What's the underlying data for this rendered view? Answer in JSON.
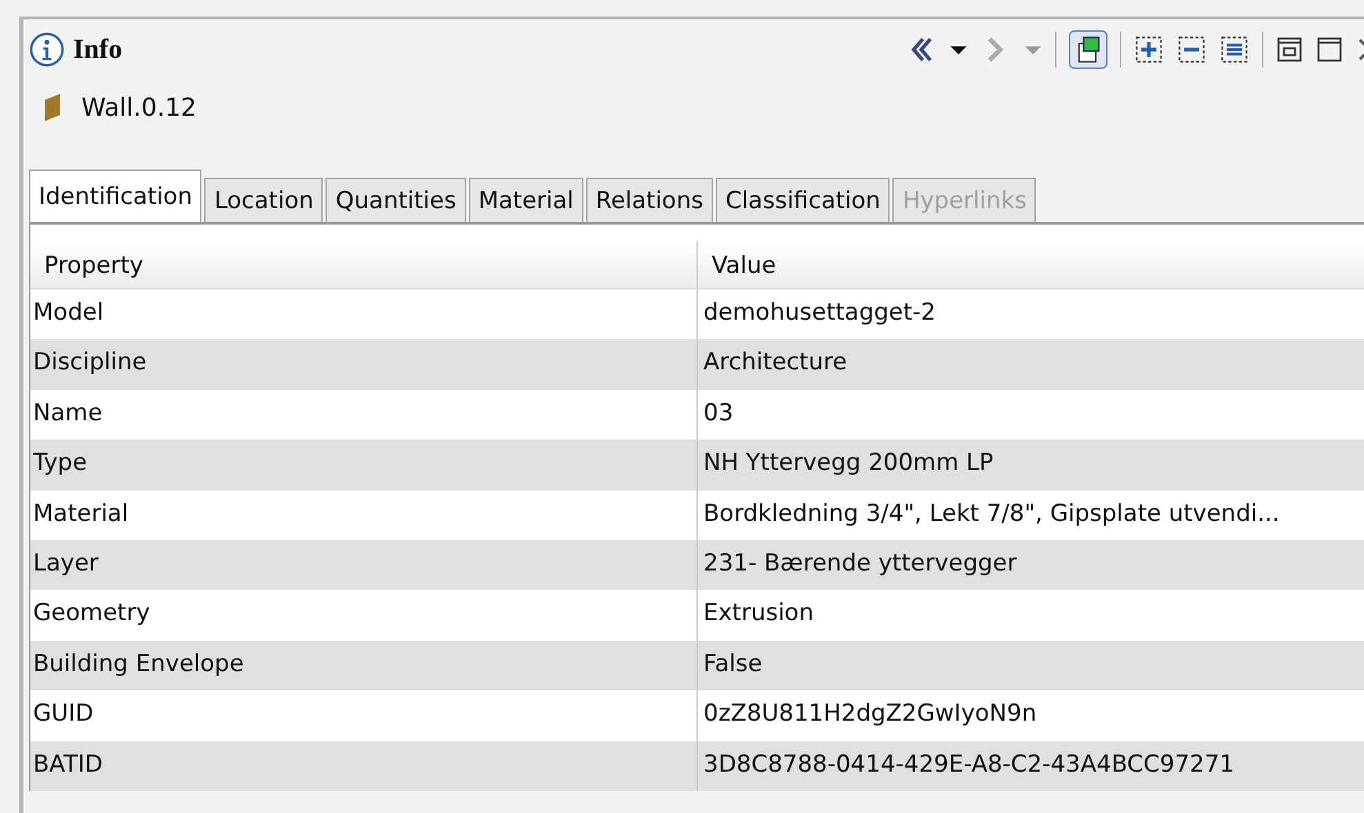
{
  "panel": {
    "title": "Info"
  },
  "object": {
    "name": "Wall.0.12"
  },
  "tabs": [
    {
      "label": "Identification",
      "selected": true,
      "disabled": false
    },
    {
      "label": "Location",
      "selected": false,
      "disabled": false
    },
    {
      "label": "Quantities",
      "selected": false,
      "disabled": false
    },
    {
      "label": "Material",
      "selected": false,
      "disabled": false
    },
    {
      "label": "Relations",
      "selected": false,
      "disabled": false
    },
    {
      "label": "Classification",
      "selected": false,
      "disabled": false
    },
    {
      "label": "Hyperlinks",
      "selected": false,
      "disabled": true
    }
  ],
  "table": {
    "columns": [
      "Property",
      "Value"
    ],
    "rows": [
      [
        "Model",
        "demohusettagget-2"
      ],
      [
        "Discipline",
        "Architecture"
      ],
      [
        "Name",
        "03"
      ],
      [
        "Type",
        "NH Yttervegg 200mm LP"
      ],
      [
        "Material",
        "Bordkledning 3/4\", Lekt 7/8\", Gipsplate utvendi..."
      ],
      [
        "Layer",
        "231- Bærende yttervegger"
      ],
      [
        "Geometry",
        "Extrusion"
      ],
      [
        "Building Envelope",
        "False"
      ],
      [
        "GUID",
        "0zZ8U811H2dgZ2GwIyoN9n"
      ],
      [
        "BATID",
        "3D8C8788-0414-429E-A8-C2-43A4BCC97271"
      ]
    ]
  }
}
